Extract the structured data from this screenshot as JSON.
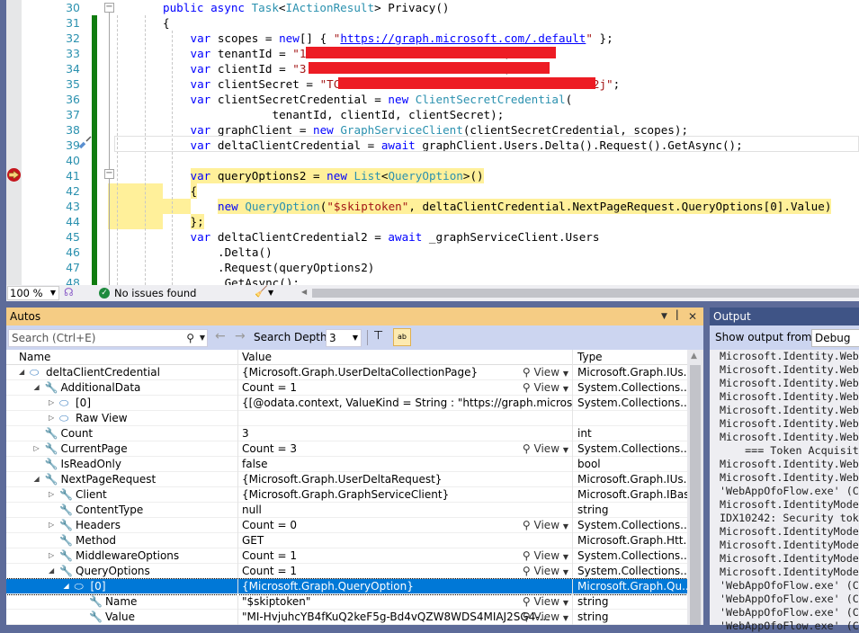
{
  "editor": {
    "lines": [
      {
        "n": "30",
        "segs": [
          [
            "kw",
            "public async "
          ],
          [
            "ty",
            "Task"
          ],
          [
            "tx",
            "<"
          ],
          [
            "ty",
            "IActionResult"
          ],
          [
            "tx",
            "> Privacy()"
          ]
        ],
        "indent": 2
      },
      {
        "n": "31",
        "segs": [
          [
            "tx",
            "{"
          ]
        ],
        "indent": 2
      },
      {
        "n": "32",
        "segs": [
          [
            "kw",
            "var "
          ],
          [
            "tx",
            "scopes = "
          ],
          [
            "kw",
            "new"
          ],
          [
            "tx",
            "[] { "
          ],
          [
            "st",
            "\""
          ],
          [
            "url",
            "https://graph.microsoft.com/.default"
          ],
          [
            "st",
            "\""
          ],
          [
            "tx",
            " };"
          ]
        ],
        "indent": 3
      },
      {
        "n": "33",
        "segs": [
          [
            "kw",
            "var "
          ],
          [
            "tx",
            "tenantId = "
          ],
          [
            "st",
            "\"1                            \""
          ],
          [
            "tx",
            ";"
          ]
        ],
        "indent": 3
      },
      {
        "n": "34",
        "segs": [
          [
            "kw",
            "var "
          ],
          [
            "tx",
            "clientId = "
          ],
          [
            "st",
            "\"3                           7\""
          ],
          [
            "tx",
            ";"
          ]
        ],
        "indent": 3
      },
      {
        "n": "35",
        "segs": [
          [
            "kw",
            "var "
          ],
          [
            "tx",
            "clientSecret = "
          ],
          [
            "st",
            "\"TC                                     2j\""
          ],
          [
            "tx",
            ";"
          ]
        ],
        "indent": 3
      },
      {
        "n": "36",
        "segs": [
          [
            "kw",
            "var "
          ],
          [
            "tx",
            "clientSecretCredential = "
          ],
          [
            "kw",
            "new "
          ],
          [
            "ty",
            "ClientSecretCredential"
          ],
          [
            "tx",
            "("
          ]
        ],
        "indent": 3
      },
      {
        "n": "37",
        "segs": [
          [
            "tx",
            "            tenantId, clientId, clientSecret);"
          ]
        ],
        "indent": 3
      },
      {
        "n": "38",
        "segs": [
          [
            "kw",
            "var "
          ],
          [
            "tx",
            "graphClient = "
          ],
          [
            "kw",
            "new "
          ],
          [
            "ty",
            "GraphServiceClient"
          ],
          [
            "tx",
            "(clientSecretCredential, scopes);"
          ]
        ],
        "indent": 3
      },
      {
        "n": "39",
        "segs": [
          [
            "kw",
            "var "
          ],
          [
            "tx",
            "deltaClientCredential = "
          ],
          [
            "kw",
            "await "
          ],
          [
            "tx",
            "graphClient.Users.Delta().Request().GetAsync();"
          ]
        ],
        "indent": 3
      },
      {
        "n": "40",
        "segs": [],
        "indent": 3
      },
      {
        "n": "41",
        "segs": [
          [
            "kw",
            "var "
          ],
          [
            "tx",
            "queryOptions2 = "
          ],
          [
            "kw",
            "new "
          ],
          [
            "ty",
            "List"
          ],
          [
            "tx",
            "<"
          ],
          [
            "ty",
            "QueryOption"
          ],
          [
            "tx",
            ">()"
          ]
        ],
        "indent": 3,
        "hl": true
      },
      {
        "n": "42",
        "segs": [
          [
            "tx",
            "{"
          ]
        ],
        "indent": 3,
        "hl": true
      },
      {
        "n": "43",
        "segs": [
          [
            "kw",
            "new "
          ],
          [
            "ty",
            "QueryOption"
          ],
          [
            "tx",
            "("
          ],
          [
            "st",
            "\"$skiptoken\""
          ],
          [
            "tx",
            ", deltaClientCredential.NextPageRequest.QueryOptions[0].Value)"
          ]
        ],
        "indent": 4,
        "hl": true
      },
      {
        "n": "44",
        "segs": [
          [
            "tx",
            "};"
          ]
        ],
        "indent": 3,
        "hl": true
      },
      {
        "n": "45",
        "segs": [
          [
            "kw",
            "var "
          ],
          [
            "tx",
            "deltaClientCredential2 = "
          ],
          [
            "kw",
            "await "
          ],
          [
            "tx",
            "_graphServiceClient.Users"
          ]
        ],
        "indent": 3
      },
      {
        "n": "46",
        "segs": [
          [
            "tx",
            ".Delta()"
          ]
        ],
        "indent": 4
      },
      {
        "n": "47",
        "segs": [
          [
            "tx",
            ".Request(queryOptions2)"
          ]
        ],
        "indent": 4
      },
      {
        "n": "48",
        "segs": [
          [
            "tx",
            ".GetAsync();"
          ]
        ],
        "indent": 4
      }
    ],
    "status": {
      "zoom": "100 %",
      "issues": "No issues found"
    }
  },
  "autos": {
    "title": "Autos",
    "search_placeholder": "Search (Ctrl+E)",
    "search_depth_label": "Search Depth:",
    "search_depth": "3",
    "columns": {
      "name": "Name",
      "value": "Value",
      "type": "Type"
    },
    "view_label": "View",
    "rows": [
      {
        "level": 0,
        "exp": "open",
        "icon": "object-icon",
        "name": "deltaClientCredential",
        "value": "{Microsoft.Graph.UserDeltaCollectionPage}",
        "view": true,
        "type": "Microsoft.Graph.IUs..."
      },
      {
        "level": 1,
        "exp": "open",
        "icon": "wrench-icon",
        "name": "AdditionalData",
        "value": "Count = 1",
        "view": true,
        "type": "System.Collections...."
      },
      {
        "level": 2,
        "exp": "closed",
        "icon": "object-icon",
        "name": "[0]",
        "value": "{[@odata.context, ValueKind = String : \"https://graph.microsoft.co...",
        "view": false,
        "type": "System.Collections...."
      },
      {
        "level": 2,
        "exp": "closed",
        "icon": "object-icon",
        "name": "Raw View",
        "value": "",
        "view": false,
        "type": ""
      },
      {
        "level": 1,
        "exp": "none",
        "icon": "wrench-icon",
        "name": "Count",
        "value": "3",
        "view": false,
        "type": "int"
      },
      {
        "level": 1,
        "exp": "closed",
        "icon": "wrench-icon",
        "name": "CurrentPage",
        "value": "Count = 3",
        "view": true,
        "type": "System.Collections...."
      },
      {
        "level": 1,
        "exp": "none",
        "icon": "wrench-icon",
        "name": "IsReadOnly",
        "value": "false",
        "view": false,
        "type": "bool"
      },
      {
        "level": 1,
        "exp": "open",
        "icon": "wrench-icon",
        "name": "NextPageRequest",
        "value": "{Microsoft.Graph.UserDeltaRequest}",
        "view": false,
        "type": "Microsoft.Graph.IUs..."
      },
      {
        "level": 2,
        "exp": "closed",
        "icon": "wrench-icon",
        "name": "Client",
        "value": "{Microsoft.Graph.GraphServiceClient}",
        "view": false,
        "type": "Microsoft.Graph.IBas..."
      },
      {
        "level": 2,
        "exp": "none",
        "icon": "wrench-icon",
        "name": "ContentType",
        "value": "null",
        "view": false,
        "type": "string"
      },
      {
        "level": 2,
        "exp": "closed",
        "icon": "wrench-icon",
        "name": "Headers",
        "value": "Count = 0",
        "view": true,
        "type": "System.Collections...."
      },
      {
        "level": 2,
        "exp": "none",
        "icon": "wrench-icon",
        "name": "Method",
        "value": "GET",
        "view": false,
        "type": "Microsoft.Graph.Htt..."
      },
      {
        "level": 2,
        "exp": "closed",
        "icon": "wrench-icon",
        "name": "MiddlewareOptions",
        "value": "Count = 1",
        "view": true,
        "type": "System.Collections...."
      },
      {
        "level": 2,
        "exp": "open",
        "icon": "wrench-icon",
        "name": "QueryOptions",
        "value": "Count = 1",
        "view": true,
        "type": "System.Collections...."
      },
      {
        "level": 3,
        "exp": "open",
        "icon": "object-icon",
        "name": "[0]",
        "value": "{Microsoft.Graph.QueryOption}",
        "view": false,
        "type": "Microsoft.Graph.Qu...",
        "selected": true
      },
      {
        "level": 4,
        "exp": "none",
        "icon": "wrench-icon",
        "name": "Name",
        "value": "\"$skiptoken\"",
        "view": true,
        "type": "string"
      },
      {
        "level": 4,
        "exp": "none",
        "icon": "wrench-icon",
        "name": "Value",
        "value": "\"MI-HvjuhcYB4fKuQ2keF5g-Bd4vQZW8WDS4MIAJ2SG4-...",
        "view": true,
        "type": "string"
      }
    ]
  },
  "output": {
    "title": "Output",
    "show_from_label": "Show output from:",
    "source": "Debug",
    "lines": [
      "Microsoft.Identity.Web",
      "Microsoft.Identity.Web",
      "Microsoft.Identity.Web",
      "Microsoft.Identity.Web",
      "Microsoft.Identity.Web",
      "Microsoft.Identity.Web",
      "Microsoft.Identity.Web",
      "    === Token Acquisit",
      "Microsoft.Identity.Web",
      "Microsoft.Identity.Web",
      "'WebAppOfoFlow.exe' (C",
      "Microsoft.IdentityMode",
      "IDX10242: Security tok",
      "Microsoft.IdentityMode",
      "Microsoft.IdentityMode",
      "Microsoft.IdentityMode",
      "Microsoft.IdentityMode",
      "'WebAppOfoFlow.exe' (C",
      "'WebAppOfoFlow.exe' (C",
      "'WebAppOfoFlow.exe' (C",
      "'WebAppOfoFlow.exe' (C"
    ]
  },
  "colors": {
    "accent": "#0078d7",
    "autos_title_bg": "#f5cc84",
    "output_title_bg": "#3f5486",
    "highlight": "#fff09a",
    "redaction": "#ed1c24",
    "change_bar": "#107c10"
  }
}
